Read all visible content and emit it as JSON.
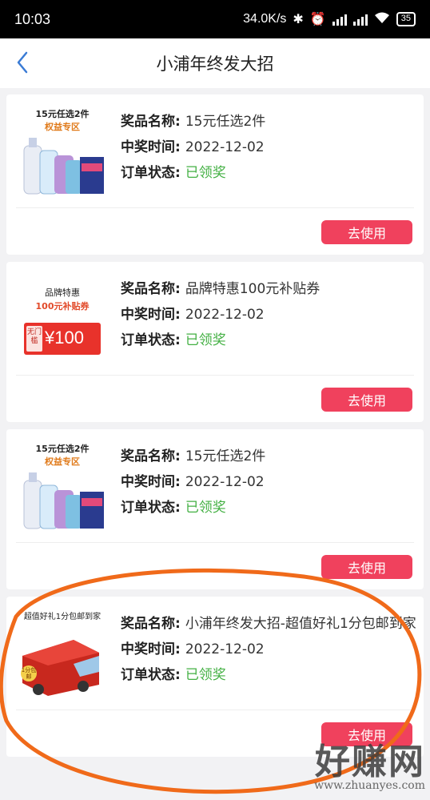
{
  "status_bar": {
    "time": "10:03",
    "speed": "34.0K/s",
    "battery": "35",
    "hd1": "HD",
    "hd2": "HD"
  },
  "header": {
    "title": "小浦年终发大招"
  },
  "labels": {
    "name": "奖品名称:",
    "time": "中奖时间:",
    "status": "订单状态:"
  },
  "cards": [
    {
      "thumb_title": "15元任选2件",
      "thumb_sub": "权益专区",
      "name": "15元任选2件",
      "time": "2022-12-02",
      "status": "已领奖",
      "button": "去使用"
    },
    {
      "thumb_title": "品牌特惠",
      "thumb_sub": "100元补贴券",
      "coupon_tag": "无门槛",
      "coupon_amount": "¥100",
      "name": "品牌特惠100元补贴券",
      "time": "2022-12-02",
      "status": "已领奖",
      "button": "去使用"
    },
    {
      "thumb_title": "15元任选2件",
      "thumb_sub": "权益专区",
      "name": "15元任选2件",
      "time": "2022-12-02",
      "status": "已领奖",
      "button": "去使用"
    },
    {
      "thumb_title": "超值好礼1分包邮到家",
      "van_badge": "1分包邮",
      "name": "小浦年终发大招-超值好礼1分包邮到家",
      "time": "2022-12-02",
      "status": "已领奖",
      "button": "去使用"
    }
  ],
  "watermark": {
    "text": "好赚网",
    "url": "www.zhuanyes.com"
  },
  "colors": {
    "accent": "#f0415d",
    "status_green": "#43b043"
  }
}
